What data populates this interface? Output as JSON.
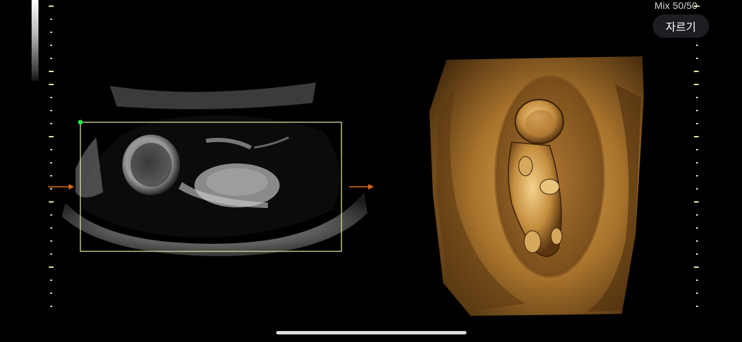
{
  "header": {
    "mix_label": "Mix 50/50-",
    "mix_sub_label": "",
    "crop_button_label": "자르기"
  },
  "colors": {
    "background": "#000000",
    "roi_box": "#d7e0a0",
    "roi_marker": "#32e04a",
    "axis_arrow": "#e06a1a",
    "render_tint": "#b9812f"
  },
  "icons": {
    "left_arrow": "arrow-right-icon",
    "right_arrow": "arrow-right-icon"
  }
}
